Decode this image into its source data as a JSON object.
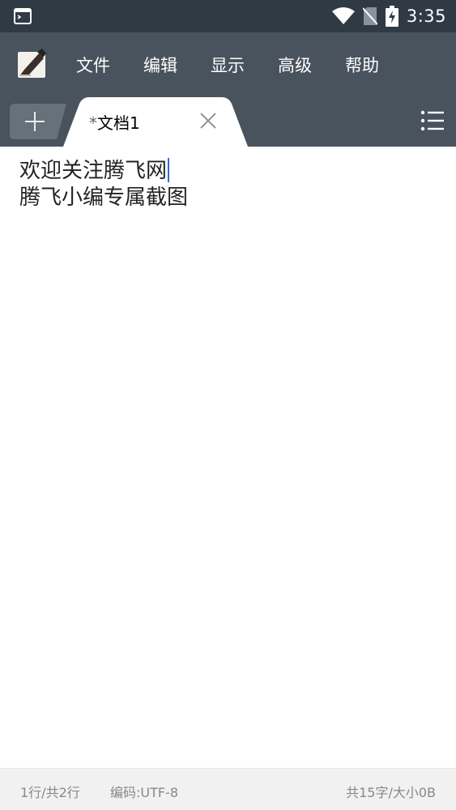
{
  "status_bar": {
    "time": "3:35",
    "icons": [
      "terminal-icon",
      "wifi-icon",
      "no-sim-icon",
      "battery-charging-icon"
    ]
  },
  "toolbar": {
    "menu": [
      "文件",
      "编辑",
      "显示",
      "高级",
      "帮助"
    ],
    "icons": [
      "app-logo-icon"
    ]
  },
  "tabs": {
    "active": {
      "dirty_marker": "*",
      "title": "文档1"
    },
    "icons": [
      "plus-icon",
      "close-icon",
      "list-menu-icon"
    ]
  },
  "editor": {
    "lines": [
      "欢迎关注腾飞网",
      "腾飞小编专属截图"
    ]
  },
  "footer": {
    "line_info": "1行/共2行",
    "encoding": "编码:UTF-8",
    "size_info": "共15字/大小0B"
  },
  "colors": {
    "status_bar": "#2f3a44",
    "toolbar": "#48535d",
    "tab_active": "#ffffff",
    "cursor": "#2b6fd6",
    "footer": "#f1f1f1"
  }
}
